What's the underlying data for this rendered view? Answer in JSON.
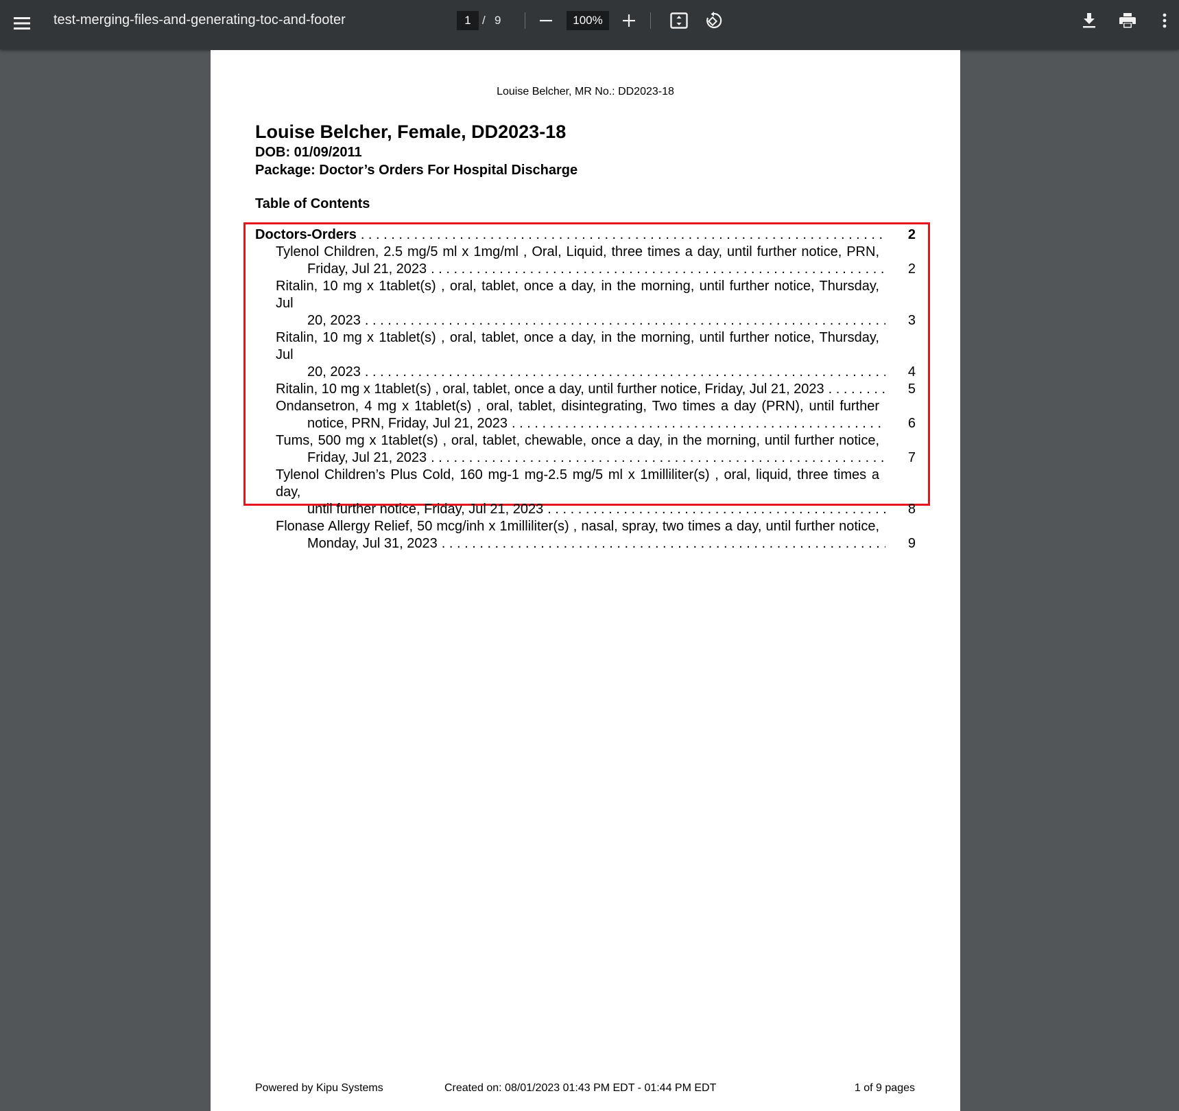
{
  "toolbar": {
    "title": "test-merging-files-and-generating-toc-and-footer",
    "page_current": "1",
    "page_separator": "/",
    "page_total": "9",
    "zoom": "100%",
    "icons": [
      "menu-icon",
      "zoom-out-icon",
      "zoom-in-icon",
      "fit-page-icon",
      "rotate-icon",
      "download-icon",
      "print-icon",
      "more-vert-icon"
    ]
  },
  "page": {
    "running_header": "Louise Belcher, MR No.: DD2023-18",
    "patient_title": "Louise Belcher, Female, DD2023-18",
    "dob": "DOB: 01/09/2011",
    "package": "Package: Doctor’s Orders For Hospital Discharge",
    "toc_heading": "Table of Contents",
    "toc": {
      "section": {
        "label": "Doctors-Orders",
        "page": "2"
      },
      "entries": [
        {
          "line1": "Tylenol Children, 2.5 mg/5 ml x 1mg/ml , Oral, Liquid, three times a day, until further notice, PRN,",
          "line2": "Friday, Jul 21, 2023",
          "page": "2"
        },
        {
          "line1": "Ritalin, 10 mg x 1tablet(s) , oral, tablet, once a day, in the morning, until further notice, Thursday, Jul",
          "line2": "20, 2023",
          "page": "3"
        },
        {
          "line1": "Ritalin, 10 mg x 1tablet(s) , oral, tablet, once a day, in the morning, until further notice, Thursday, Jul",
          "line2": "20, 2023",
          "page": "4"
        },
        {
          "line1": "",
          "single": "Ritalin, 10 mg x 1tablet(s) , oral, tablet, once a day, until further notice, Friday, Jul 21, 2023",
          "page": "5"
        },
        {
          "line1": "Ondansetron, 4 mg x 1tablet(s) , oral, tablet, disintegrating, Two times a day (PRN), until further",
          "line2": "notice, PRN, Friday, Jul 21, 2023",
          "page": "6"
        },
        {
          "line1": "Tums, 500 mg x 1tablet(s) , oral, tablet, chewable, once a day, in the morning, until further notice,",
          "line2": "Friday, Jul 21, 2023",
          "page": "7"
        },
        {
          "line1": "Tylenol Children’s Plus Cold, 160 mg-1 mg-2.5 mg/5 ml x 1milliliter(s) , oral, liquid, three times a day,",
          "line2": "until further notice, Friday, Jul 21, 2023",
          "page": "8"
        },
        {
          "line1": "Flonase Allergy Relief, 50 mcg/inh x 1milliliter(s) , nasal, spray, two times a day, until further notice,",
          "line2": "Monday, Jul 31, 2023",
          "page": "9"
        }
      ]
    },
    "footer": {
      "left": "Powered by Kipu Systems",
      "center": "Created on: 08/01/2023 01:43 PM EDT - 01:44 PM EDT",
      "right": "1 of 9 pages"
    }
  },
  "colors": {
    "toolbar_bg": "#323639",
    "viewer_bg": "#525659",
    "highlight": "#e5141d"
  }
}
